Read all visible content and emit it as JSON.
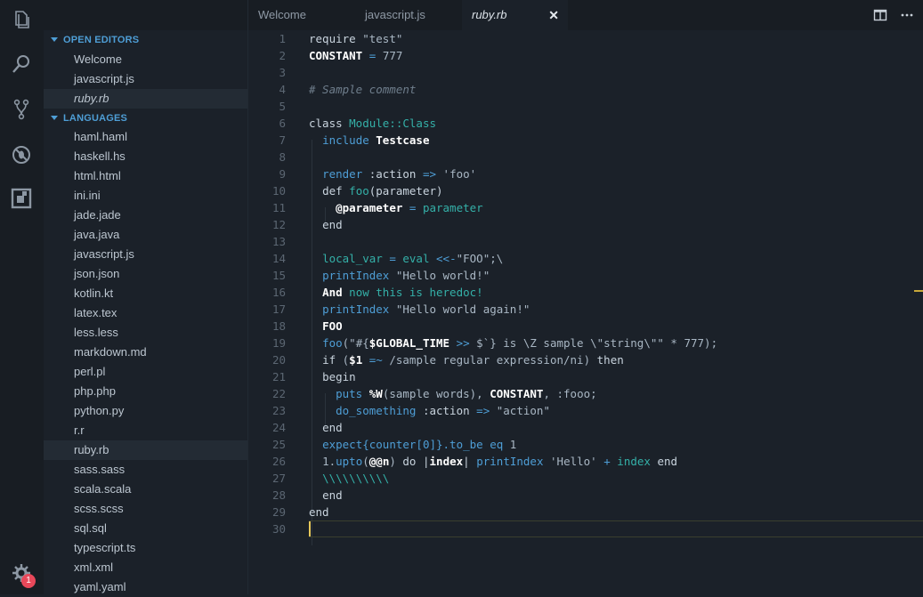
{
  "colors": {
    "background": "#1b2129",
    "activity_bar": "#181d23",
    "accent_blue": "#4e9ed6",
    "teal": "#34b0a8",
    "badge_red": "#e8485a",
    "cursor_yellow": "#e6c85a"
  },
  "activity_bar": {
    "icons": [
      "files-icon",
      "search-icon",
      "source-control-icon",
      "debug-icon",
      "extensions-icon"
    ],
    "settings_badge": "1"
  },
  "sidebar": {
    "open_editors_title": "OPEN EDITORS",
    "open_editors": [
      {
        "label": "Welcome",
        "italic": false
      },
      {
        "label": "javascript.js",
        "italic": false
      },
      {
        "label": "ruby.rb",
        "italic": true
      }
    ],
    "languages_title": "LANGUAGES",
    "languages": [
      "haml.haml",
      "haskell.hs",
      "html.html",
      "ini.ini",
      "jade.jade",
      "java.java",
      "javascript.js",
      "json.json",
      "kotlin.kt",
      "latex.tex",
      "less.less",
      "markdown.md",
      "perl.pl",
      "php.php",
      "python.py",
      "r.r",
      "ruby.rb",
      "sass.sass",
      "scala.scala",
      "scss.scss",
      "sql.sql",
      "typescript.ts",
      "xml.xml",
      "yaml.yaml"
    ],
    "active_language": "ruby.rb"
  },
  "tabs": [
    {
      "label": "Welcome",
      "active": false
    },
    {
      "label": "javascript.js",
      "active": false
    },
    {
      "label": "ruby.rb",
      "active": true,
      "close": "✕"
    }
  ],
  "editor": {
    "current_line": 30,
    "lines": [
      [
        [
          "k",
          "require "
        ],
        [
          "s",
          "\"test\""
        ]
      ],
      [
        [
          "w2",
          "CONSTANT"
        ],
        [
          "p",
          " "
        ],
        [
          "n",
          "="
        ],
        [
          "p",
          " "
        ],
        [
          "s",
          "777"
        ]
      ],
      [],
      [
        [
          "c",
          "# Sample comment"
        ]
      ],
      [],
      [
        [
          "k",
          "class "
        ],
        [
          "t",
          "Module::Class"
        ]
      ],
      [
        [
          "p",
          "  "
        ],
        [
          "n",
          "include "
        ],
        [
          "w",
          "Testcase"
        ]
      ],
      [],
      [
        [
          "p",
          "  "
        ],
        [
          "n",
          "render "
        ],
        [
          "k",
          ":action "
        ],
        [
          "n",
          "=>"
        ],
        [
          "s",
          " 'foo'"
        ]
      ],
      [
        [
          "p",
          "  "
        ],
        [
          "k",
          "def "
        ],
        [
          "t",
          "foo"
        ],
        [
          "k",
          "(parameter)"
        ]
      ],
      [
        [
          "p",
          "    "
        ],
        [
          "w",
          "@parameter"
        ],
        [
          "n",
          " = "
        ],
        [
          "t",
          "parameter"
        ]
      ],
      [
        [
          "p",
          "  "
        ],
        [
          "k",
          "end"
        ]
      ],
      [],
      [
        [
          "p",
          "  "
        ],
        [
          "t",
          "local_var"
        ],
        [
          "n",
          " = "
        ],
        [
          "t",
          "eval"
        ],
        [
          "p",
          " "
        ],
        [
          "n",
          "<<-"
        ],
        [
          "s",
          "\"FOO\";\\"
        ]
      ],
      [
        [
          "p",
          "  "
        ],
        [
          "n",
          "printIndex "
        ],
        [
          "s",
          "\"Hello world!\""
        ]
      ],
      [
        [
          "p",
          "  "
        ],
        [
          "w",
          "And "
        ],
        [
          "t",
          "now this is heredoc!"
        ]
      ],
      [
        [
          "p",
          "  "
        ],
        [
          "n",
          "printIndex "
        ],
        [
          "s",
          "\"Hello world again!\""
        ]
      ],
      [
        [
          "p",
          "  "
        ],
        [
          "w",
          "FOO"
        ]
      ],
      [
        [
          "p",
          "  "
        ],
        [
          "n",
          "foo"
        ],
        [
          "s",
          "(\"#{"
        ],
        [
          "w",
          "$GLOBAL_TIME"
        ],
        [
          "n",
          " >> "
        ],
        [
          "s",
          "$`} is \\Z sample \\\"string\\\"\" * 777);"
        ]
      ],
      [
        [
          "p",
          "  "
        ],
        [
          "k",
          "if "
        ],
        [
          "s",
          "("
        ],
        [
          "w",
          "$1"
        ],
        [
          "n",
          " =~ "
        ],
        [
          "s",
          "/sample regular expression/ni) "
        ],
        [
          "k",
          "then"
        ]
      ],
      [
        [
          "p",
          "  "
        ],
        [
          "k",
          "begin"
        ]
      ],
      [
        [
          "p",
          "    "
        ],
        [
          "n",
          "puts "
        ],
        [
          "w",
          "%W"
        ],
        [
          "s",
          "(sample words), "
        ],
        [
          "w",
          "CONSTANT"
        ],
        [
          "s",
          ", :fooo;"
        ]
      ],
      [
        [
          "p",
          "    "
        ],
        [
          "n",
          "do_something "
        ],
        [
          "k",
          ":action "
        ],
        [
          "n",
          "=>"
        ],
        [
          "s",
          " \"action\""
        ]
      ],
      [
        [
          "p",
          "  "
        ],
        [
          "k",
          "end"
        ]
      ],
      [
        [
          "p",
          "  "
        ],
        [
          "n",
          "expect{counter[0]}.to_be eq "
        ],
        [
          "s",
          "1"
        ]
      ],
      [
        [
          "p",
          "  "
        ],
        [
          "s",
          "1."
        ],
        [
          "n",
          "upto"
        ],
        [
          "s",
          "("
        ],
        [
          "w",
          "@@n"
        ],
        [
          "s",
          ") "
        ],
        [
          "k",
          "do "
        ],
        [
          "p",
          "|"
        ],
        [
          "w",
          "index"
        ],
        [
          "p",
          "| "
        ],
        [
          "n",
          "printIndex "
        ],
        [
          "s",
          "'Hello' "
        ],
        [
          "n",
          "+ "
        ],
        [
          "t",
          "index "
        ],
        [
          "k",
          "end"
        ]
      ],
      [
        [
          "p",
          "  "
        ],
        [
          "t",
          "\\\\\\\\\\\\\\\\\\\\"
        ]
      ],
      [
        [
          "p",
          "  "
        ],
        [
          "k",
          "end"
        ]
      ],
      [
        [
          "k",
          "end"
        ]
      ],
      []
    ]
  }
}
